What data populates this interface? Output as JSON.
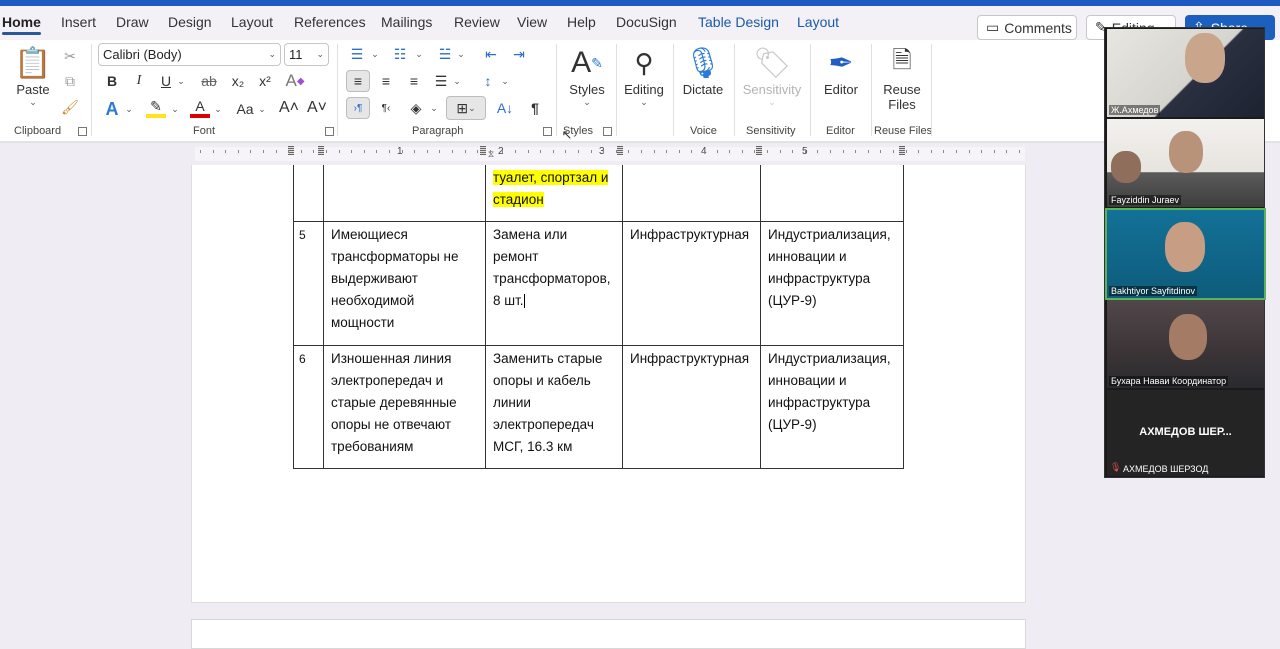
{
  "ribbon_tabs": [
    {
      "label": "Home",
      "active": true
    },
    {
      "label": "Insert"
    },
    {
      "label": "Draw"
    },
    {
      "label": "Design"
    },
    {
      "label": "Layout"
    },
    {
      "label": "References"
    },
    {
      "label": "Mailings"
    },
    {
      "label": "Review"
    },
    {
      "label": "View"
    },
    {
      "label": "Help"
    },
    {
      "label": "DocuSign"
    },
    {
      "label": "Table Design",
      "contextual": true
    },
    {
      "label": "Layout",
      "contextual": true
    }
  ],
  "top_actions": {
    "comments": "Comments",
    "editing": "Editing",
    "share": "Share"
  },
  "clipboard": {
    "paste": "Paste",
    "group": "Clipboard"
  },
  "font": {
    "name": "Calibri (Body)",
    "size": "11",
    "group": "Font",
    "bold": "B",
    "italic": "I",
    "underline": "U",
    "strike": "ab",
    "subscript": "x₂",
    "superscript": "x²",
    "change_case": "Aa",
    "grow": "A˄",
    "shrink": "A˅"
  },
  "paragraph": {
    "group": "Paragraph"
  },
  "styles": {
    "label": "Styles",
    "group": "Styles"
  },
  "editing": {
    "label": "Editing"
  },
  "voice": {
    "label": "Dictate",
    "group": "Voice"
  },
  "sensitivity": {
    "label": "Sensitivity",
    "group": "Sensitivity"
  },
  "editor": {
    "label": "Editor",
    "group": "Editor"
  },
  "reuse": {
    "label1": "Reuse",
    "label2": "Files",
    "group": "Reuse Files"
  },
  "ruler": {
    "numbers": [
      "1",
      "2",
      "3",
      "4",
      "5"
    ]
  },
  "table": {
    "top_row": {
      "col3_line1": "туалет, спортзал и",
      "col3_line2": "стадион"
    },
    "rows": [
      {
        "num": "5",
        "problem": [
          "Имеющиеся",
          "трансформаторы не",
          "выдерживают",
          "необходимой",
          "мощности"
        ],
        "solution": [
          "Замена или",
          "ремонт",
          "трансформаторов,",
          "8 шт."
        ],
        "type": "Инфраструктурная",
        "goal": [
          "Индустриализация,",
          "инновации и",
          "инфраструктура",
          "(ЦУР-9)"
        ]
      },
      {
        "num": "6",
        "problem": [
          "Изношенная линия",
          "электропередач и",
          "старые деревянные",
          "опоры не отвечают",
          "требованиям"
        ],
        "solution": [
          "Заменить старые",
          "опоры и кабель",
          "линии",
          "электропередач",
          "МСГ, 16.3 км"
        ],
        "type": "Инфраструктурная",
        "goal": [
          "Индустриализация,",
          "инновации и",
          "инфраструктура",
          "(ЦУР-9)"
        ]
      }
    ]
  },
  "video_call": {
    "participants": [
      {
        "name": "Ж.Ахмедов"
      },
      {
        "name": "Fayziddin Juraev"
      },
      {
        "name": "Bakhtiyor Sayfitdinov",
        "speaking": true
      },
      {
        "name": "Бухара  Навaи Координатор"
      },
      {
        "name": "АХМЕДОВ ШЕРЗОД",
        "display": "АХМЕДОВ  ШЕР...",
        "muted": true
      }
    ]
  }
}
